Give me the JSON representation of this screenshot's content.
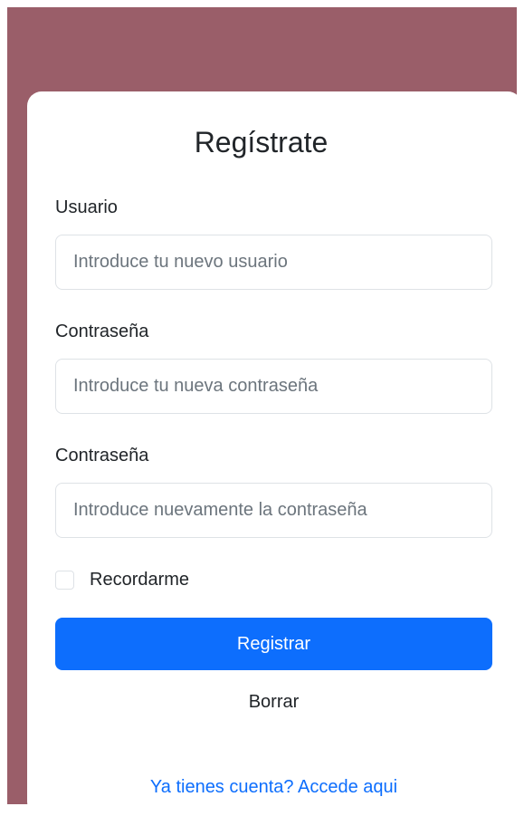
{
  "form": {
    "title": "Regístrate",
    "username": {
      "label": "Usuario",
      "placeholder": "Introduce tu nuevo usuario",
      "value": ""
    },
    "password": {
      "label": "Contraseña",
      "placeholder": "Introduce tu nueva contraseña",
      "value": ""
    },
    "password_confirm": {
      "label": "Contraseña",
      "placeholder": "Introduce nuevamente la contraseña",
      "value": ""
    },
    "remember": {
      "label": "Recordarme",
      "checked": false
    },
    "submit_label": "Registrar",
    "clear_label": "Borrar",
    "login_link_label": "Ya tienes cuenta? Accede aqui"
  },
  "colors": {
    "backdrop": "#9a5e69",
    "card": "#ffffff",
    "primary": "#0d6efd",
    "link": "#0d6efd",
    "text": "#212529",
    "placeholder": "#6c757d",
    "border": "#dee2e6"
  }
}
